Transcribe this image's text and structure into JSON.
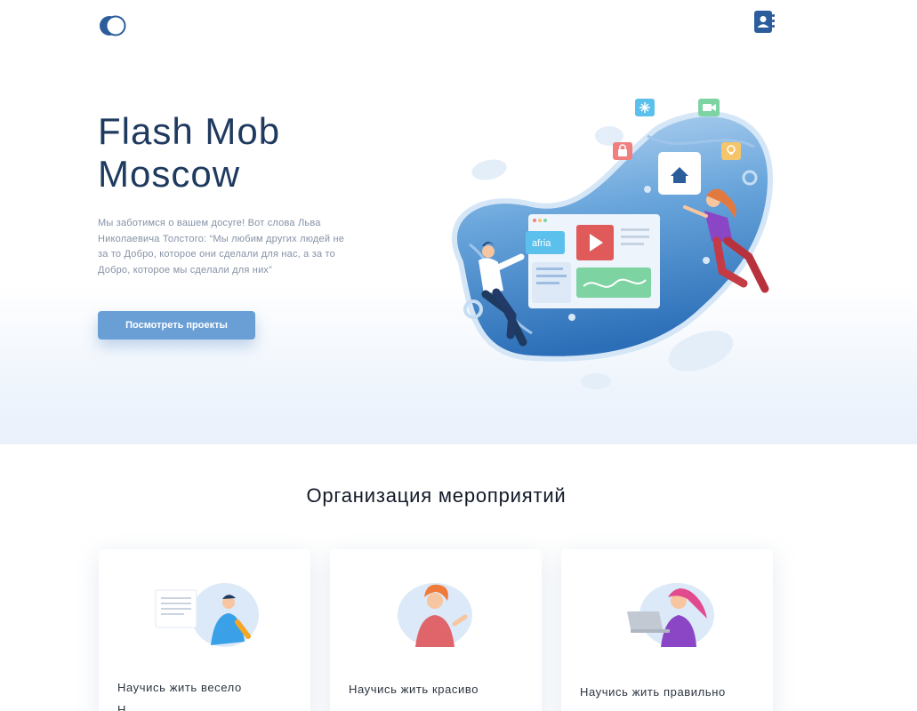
{
  "hero": {
    "title_line1": "Flash Mob",
    "title_line2": "Moscow",
    "description": "Мы заботимся о вашем досуге! Вот слова Льва Николаевича Толстого: “Мы любим других людей не за то Добро, которое они сделали для нас, а за то Добро, которое мы сделали для них”",
    "cta_label": "Посмотреть проекты",
    "illustration": {
      "screen_tag": "afria",
      "icons": [
        "snowflake-icon",
        "video-camera-icon",
        "lock-icon",
        "lightbulb-icon",
        "home-icon",
        "play-icon"
      ]
    }
  },
  "header": {
    "logo_icon": "toggle-circles-logo",
    "contact_icon": "address-book-icon"
  },
  "services": {
    "title": "Организация мероприятий",
    "cards": [
      {
        "title": "Научись жить весело",
        "sub": "Н"
      },
      {
        "title": "Научись жить красиво",
        "sub": ""
      },
      {
        "title": "Научись жить правильно",
        "sub": ""
      }
    ]
  },
  "colors": {
    "primary": "#2b5d9c",
    "title": "#1f3a5f",
    "cta": "#6a9fd6",
    "text_muted": "#8592a6",
    "hero_bg_bottom": "#eaf1fb"
  }
}
